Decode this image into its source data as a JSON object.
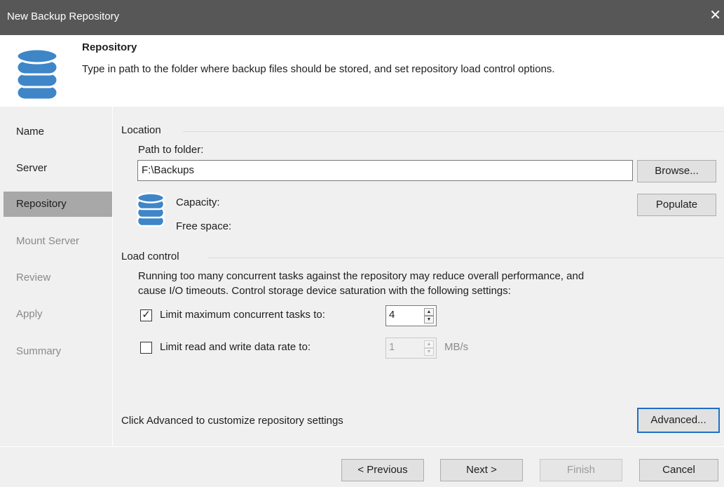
{
  "window": {
    "title": "New Backup Repository",
    "close_glyph": "✕"
  },
  "header": {
    "icon": "database-icon",
    "title": "Repository",
    "description": "Type in path to the folder where backup files should be stored, and set repository load control options."
  },
  "sidebar": {
    "items": [
      {
        "label": "Name",
        "state": "done"
      },
      {
        "label": "Server",
        "state": "done"
      },
      {
        "label": "Repository",
        "state": "active"
      },
      {
        "label": "Mount Server",
        "state": "pending"
      },
      {
        "label": "Review",
        "state": "pending"
      },
      {
        "label": "Apply",
        "state": "pending"
      },
      {
        "label": "Summary",
        "state": "pending"
      }
    ]
  },
  "location": {
    "section_title": "Location",
    "path_label": "Path to folder:",
    "path_value": "F:\\Backups",
    "browse_label": "Browse...",
    "populate_label": "Populate",
    "storage_icon": "database-icon",
    "capacity_label": "Capacity:",
    "free_space_label": "Free space:"
  },
  "load_control": {
    "section_title": "Load control",
    "description_line1": "Running too many concurrent tasks against the repository may reduce overall performance, and",
    "description_line2": "cause I/O timeouts. Control storage device saturation with the following settings:",
    "limit_tasks": {
      "label": "Limit maximum concurrent tasks to:",
      "checked": true,
      "check_glyph": "✓",
      "value": "4"
    },
    "limit_rate": {
      "label": "Limit read and write data rate to:",
      "checked": false,
      "value": "1",
      "unit": "MB/s"
    }
  },
  "advanced": {
    "hint": "Click Advanced to customize repository settings",
    "button_label": "Advanced..."
  },
  "footer": {
    "previous_label": "< Previous",
    "next_label": "Next >",
    "finish_label": "Finish",
    "cancel_label": "Cancel"
  },
  "colors": {
    "titlebar": "#575757",
    "panel": "#f0f0f0",
    "nav_active": "#a8a8a8",
    "accent": "#1f6fc6",
    "db_icon": "#3e86c8"
  },
  "spinner_arrows": {
    "up": "▲",
    "down": "▼"
  }
}
